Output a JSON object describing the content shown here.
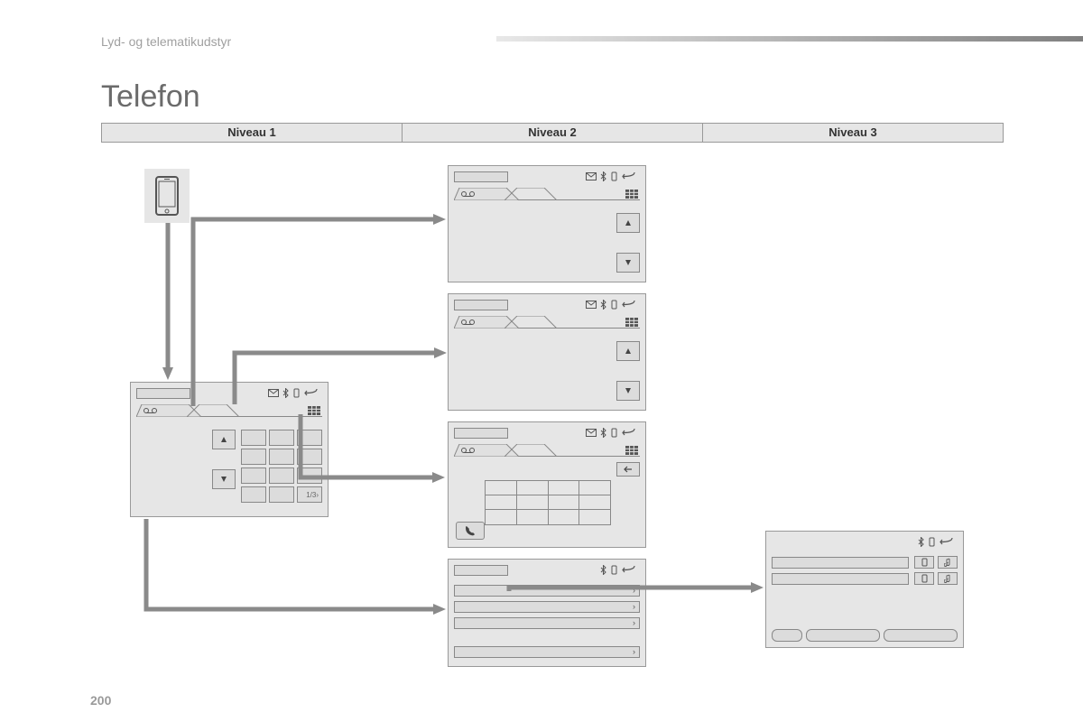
{
  "breadcrumb": "Lyd- og telematikudstyr",
  "title": "Telefon",
  "levels": [
    "Niveau 1",
    "Niveau 2",
    "Niveau 3"
  ],
  "page_number": "200",
  "keypad_indicator": "1/3›",
  "icons": {
    "phone": "phone-device-icon",
    "voicemail": "voicemail-icon",
    "envelope": "envelope-icon",
    "bluetooth": "bluetooth-icon",
    "handset": "handset-icon",
    "back": "back-icon",
    "tile": "tile-icon",
    "up": "up-arrow-icon",
    "down": "down-arrow-icon",
    "left": "left-arrow-icon",
    "call": "call-icon",
    "music": "music-note-icon",
    "chevron": "›"
  }
}
